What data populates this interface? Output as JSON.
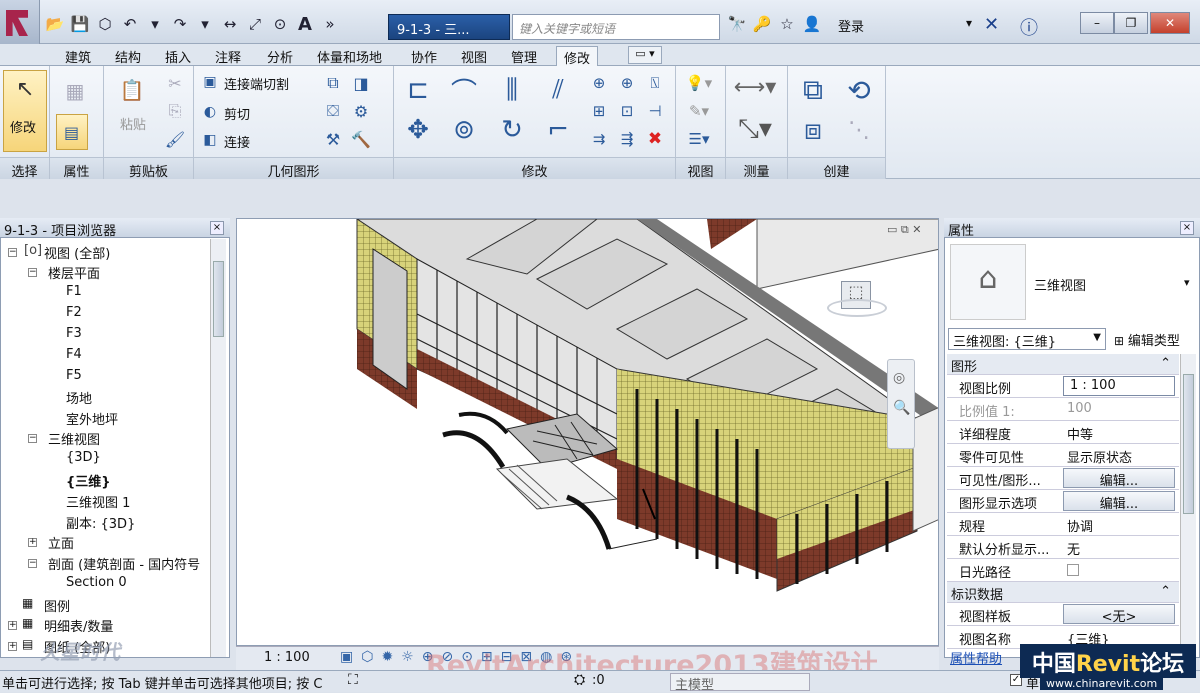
{
  "titlebar": {
    "doc_tab": "9-1-3 - 三...",
    "search_placeholder": "键入关键字或短语",
    "login": "登录",
    "text_icon": "A",
    "more": "»"
  },
  "tabs": [
    "建筑",
    "结构",
    "插入",
    "注释",
    "分析",
    "体量和场地",
    "协作",
    "视图",
    "管理",
    "修改"
  ],
  "ribbon": {
    "select_btn": "修改",
    "paste": "粘贴",
    "cut_join": "连接端切割",
    "cut": "剪切",
    "join": "连接",
    "panels": [
      "选择",
      "属性",
      "剪贴板",
      "几何图形",
      "修改",
      "视图",
      "测量",
      "创建"
    ]
  },
  "browser": {
    "title": "9-1-3 - 项目浏览器",
    "items": [
      "视图 (全部)",
      "楼层平面",
      "F1",
      "F2",
      "F3",
      "F4",
      "F5",
      "场地",
      "室外地坪",
      "三维视图",
      "{3D}",
      "{三维}",
      "三维视图 1",
      "副本: {3D}",
      "立面",
      "剖面 (建筑剖面 - 国内符号",
      "Section 0",
      "图例",
      "明细表/数量",
      "图纸 (全部)"
    ]
  },
  "properties": {
    "title": "属性",
    "type_name": "三维视图",
    "selector": "三维视图: {三维}",
    "edit_type": "编辑类型",
    "sections": [
      "图形",
      "标识数据"
    ],
    "rows": [
      {
        "k": "视图比例",
        "v": "1 : 100"
      },
      {
        "k": "比例值 1:",
        "v": "100"
      },
      {
        "k": "详细程度",
        "v": "中等"
      },
      {
        "k": "零件可见性",
        "v": "显示原状态"
      },
      {
        "k": "可见性/图形...",
        "v": "编辑..."
      },
      {
        "k": "图形显示选项",
        "v": "编辑..."
      },
      {
        "k": "规程",
        "v": "协调"
      },
      {
        "k": "默认分析显示...",
        "v": "无"
      },
      {
        "k": "日光路径",
        "v": ""
      },
      {
        "k": "视图样板",
        "v": "<无>"
      },
      {
        "k": "视图名称",
        "v": "{三维}"
      }
    ],
    "help": "属性帮助"
  },
  "viewbar": {
    "scale": "1 : 100"
  },
  "status": {
    "text": "单击可进行选择; 按 Tab 键并单击可选择其他项目; 按 C",
    "coord": ":0",
    "model": "主模型",
    "check": "单击",
    "right": "+0"
  },
  "watermark": "RevitArchitecture2013建筑设计",
  "brand": {
    "a": "中国",
    "b": "Revit",
    "c": "论坛",
    "url": "www.chinarevit.com"
  },
  "logo_text": "火星时代"
}
